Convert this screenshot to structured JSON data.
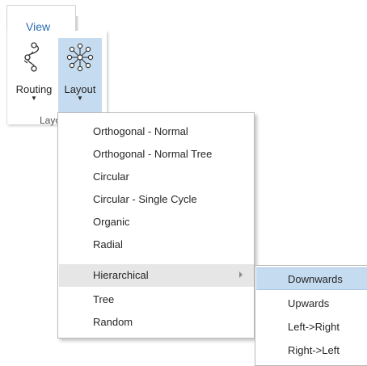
{
  "ribbon": {
    "tab_label": "View",
    "routing_label": "Routing",
    "layout_label": "Layout",
    "group_label": "Layo"
  },
  "menu": {
    "items": [
      {
        "label": "Orthogonal - Normal"
      },
      {
        "label": "Orthogonal - Normal Tree"
      },
      {
        "label": "Circular"
      },
      {
        "label": "Circular - Single Cycle"
      },
      {
        "label": "Organic"
      },
      {
        "label": "Radial"
      },
      {
        "label": "Hierarchical",
        "has_submenu": true,
        "highlighted": true
      },
      {
        "label": "Tree"
      },
      {
        "label": "Random"
      }
    ]
  },
  "submenu": {
    "items": [
      {
        "label": "Downwards",
        "highlighted": true
      },
      {
        "label": "Upwards"
      },
      {
        "label": "Left->Right"
      },
      {
        "label": "Right->Left"
      }
    ]
  },
  "colors": {
    "tab_text": "#2b6cb0",
    "selected_button": "#c5dcf0",
    "menu_hover": "#e6e6e6",
    "icon_stroke": "#333333",
    "icon_node_highlight": "#ffffff"
  }
}
